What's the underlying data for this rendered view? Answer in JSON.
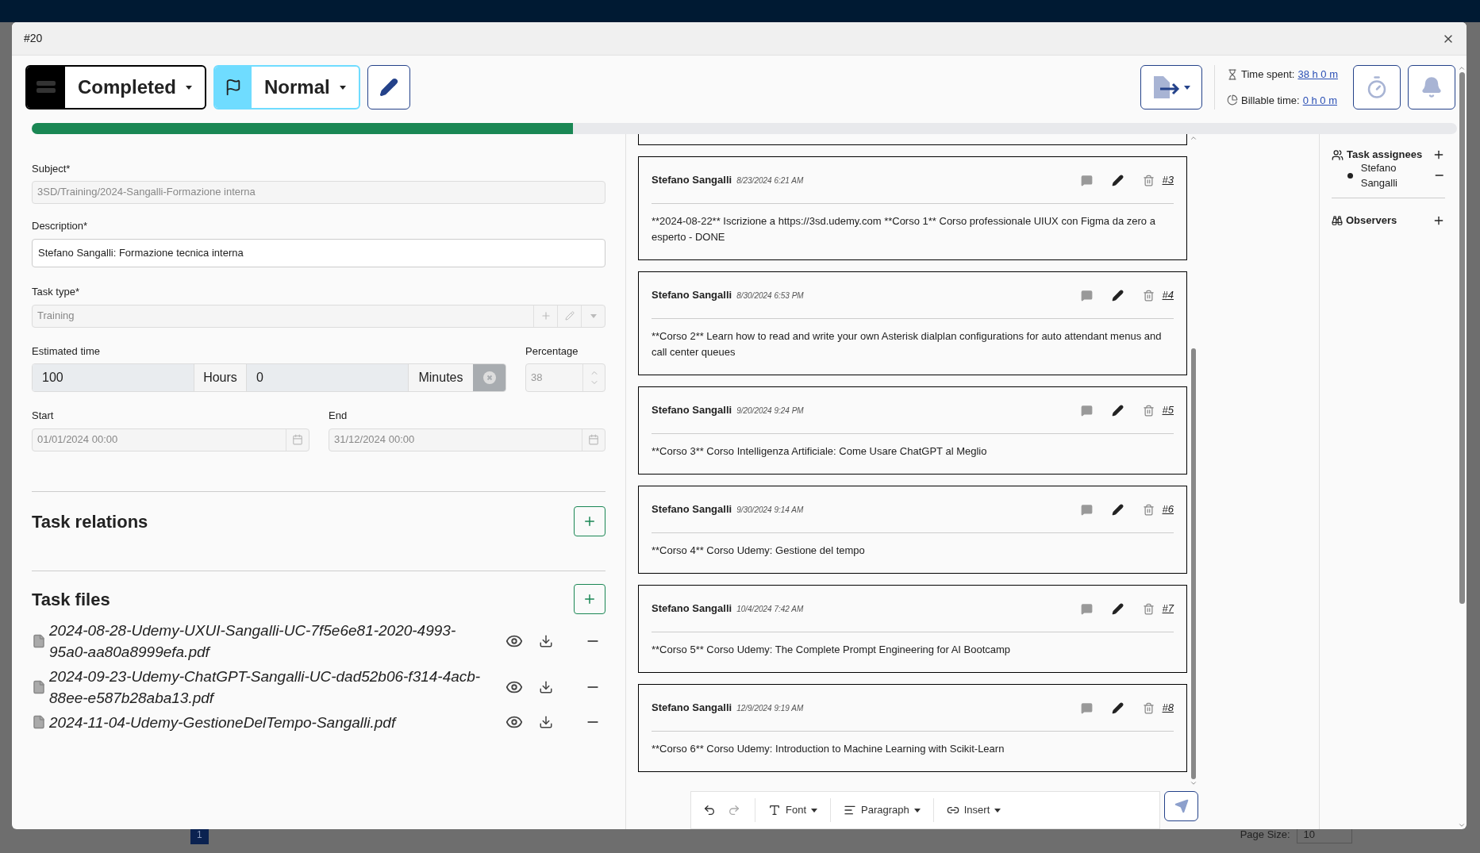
{
  "window": {
    "title": "#20"
  },
  "toolbar": {
    "status": "Completed",
    "priority": "Normal",
    "time_spent_label": "Time spent:",
    "time_spent": "38 h 0 m",
    "billable_label": "Billable time:",
    "billable": "0 h 0 m"
  },
  "progress": {
    "level": 0.38
  },
  "form": {
    "subject_label": "Subject*",
    "subject": "3SD/Training/2024-Sangalli-Formazione interna",
    "description_label": "Description*",
    "description": "Stefano Sangalli: Formazione tecnica interna",
    "task_type_label": "Task type*",
    "task_type": "Training",
    "estimated_label": "Estimated time",
    "hours": "100",
    "hours_unit": "Hours",
    "minutes": "0",
    "minutes_unit": "Minutes",
    "percentage_label": "Percentage",
    "percentage": "38",
    "start_label": "Start",
    "start": "01/01/2024 00:00",
    "end_label": "End",
    "end": "31/12/2024 00:00"
  },
  "sections": [
    {
      "title": "Task relations"
    },
    {
      "title": "Task files"
    }
  ],
  "files": [
    {
      "name": "2024-08-28-Udemy-UXUI-Sangalli-UC-7f5e6e81-2020-4993-95a0-aa80a8999efa.pdf"
    },
    {
      "name": "2024-09-23-Udemy-ChatGPT-Sangalli-UC-dad52b06-f314-4acb-88ee-e587b28aba13.pdf"
    },
    {
      "name": "2024-11-04-Udemy-GestioneDelTempo-Sangalli.pdf"
    }
  ],
  "comments": [
    {
      "author": "Stefano Sangalli",
      "time": "8/23/2024 6:21 AM",
      "number": "#3",
      "text": "**2024-08-22** Iscrizione a https://3sd.udemy.com **Corso 1** Corso professionale UIUX con Figma da zero a esperto - DONE"
    },
    {
      "author": "Stefano Sangalli",
      "time": "8/30/2024 6:53 PM",
      "number": "#4",
      "text": "**Corso 2** Learn how to read and write your own Asterisk dialplan configurations for auto attendant menus and call center queues"
    },
    {
      "author": "Stefano Sangalli",
      "time": "9/20/2024 9:24 PM",
      "number": "#5",
      "text": "**Corso 3** Corso Intelligenza Artificiale: Come Usare ChatGPT al Meglio"
    },
    {
      "author": "Stefano Sangalli",
      "time": "9/30/2024 9:14 AM",
      "number": "#6",
      "text": "**Corso 4** Corso Udemy: Gestione del tempo"
    },
    {
      "author": "Stefano Sangalli",
      "time": "10/4/2024 7:42 AM",
      "number": "#7",
      "text": "**Corso 5** Corso Udemy: The Complete Prompt Engineering for AI Bootcamp"
    },
    {
      "author": "Stefano Sangalli",
      "time": "12/9/2024 9:19 AM",
      "number": "#8",
      "text": "**Corso 6** Corso Udemy: Introduction to Machine Learning with Scikit-Learn"
    }
  ],
  "editor_toolbar": {
    "font": "Font",
    "paragraph": "Paragraph",
    "insert": "Insert"
  },
  "assignees": {
    "title": "Task assignees",
    "items": [
      {
        "name": "Stefano Sangalli"
      }
    ]
  },
  "observers": {
    "title": "Observers"
  },
  "background": {
    "page": "1",
    "page_size_label": "Page Size:",
    "page_size": "10"
  }
}
